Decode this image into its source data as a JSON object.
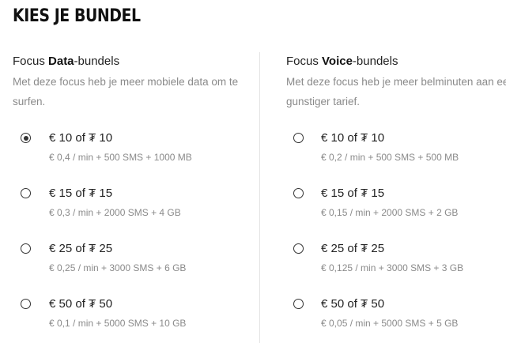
{
  "page_title": "KIES JE BUNDEL",
  "data_column": {
    "heading_prefix": "Focus ",
    "heading_bold": "Data",
    "heading_suffix": "-bundels",
    "description": "Met deze focus heb je meer mobiele data om te surfen.",
    "options": [
      {
        "price": "€ 10 of ₮ 10",
        "details": "€ 0,4 / min + 500 SMS + 1000 MB",
        "selected": true
      },
      {
        "price": "€ 15 of ₮ 15",
        "details": "€ 0,3 / min + 2000 SMS + 4 GB",
        "selected": false
      },
      {
        "price": "€ 25 of ₮ 25",
        "details": "€ 0,25 / min + 3000 SMS + 6 GB",
        "selected": false
      },
      {
        "price": "€ 50 of ₮ 50",
        "details": "€ 0,1 / min + 5000 SMS + 10 GB",
        "selected": false
      }
    ]
  },
  "voice_column": {
    "heading_prefix": "Focus ",
    "heading_bold": "Voice",
    "heading_suffix": "-bundels",
    "description": "Met deze focus heb je meer belminuten aan een gunstiger tarief.",
    "options": [
      {
        "price": "€ 10 of ₮ 10",
        "details": "€ 0,2 / min + 500 SMS + 500 MB",
        "selected": false
      },
      {
        "price": "€ 15 of ₮ 15",
        "details": "€ 0,15 / min + 2000 SMS + 2 GB",
        "selected": false
      },
      {
        "price": "€ 25 of ₮ 25",
        "details": "€ 0,125 / min + 3000 SMS + 3 GB",
        "selected": false
      },
      {
        "price": "€ 50 of ₮ 50",
        "details": "€ 0,05 / min + 5000 SMS + 5 GB",
        "selected": false
      }
    ]
  }
}
